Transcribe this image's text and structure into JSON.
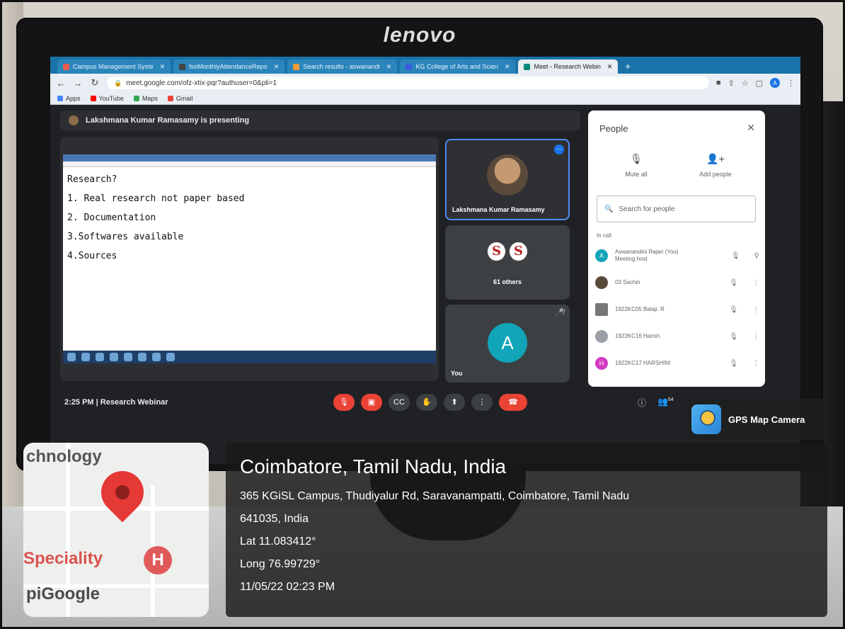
{
  "monitor": {
    "brand": "lenovo"
  },
  "browser": {
    "tabs": [
      {
        "label": "Campus Management Syste",
        "active": false
      },
      {
        "label": "fsoMonthlyAttendanceRepo",
        "active": false
      },
      {
        "label": "Search results - aswanandi",
        "active": false
      },
      {
        "label": "KG College of Arts and Scien",
        "active": false
      },
      {
        "label": "Meet - Research Webin",
        "active": true
      }
    ],
    "new_tab": "+",
    "url": "meet.google.com/ofz-xtix-pqr?authuser=0&pli=1",
    "bookmarks": [
      {
        "label": "Apps",
        "color": "#4285f4"
      },
      {
        "label": "YouTube",
        "color": "#ff0000"
      },
      {
        "label": "Maps",
        "color": "#34a853"
      },
      {
        "label": "Gmail",
        "color": "#ea4335"
      }
    ],
    "profile_initial": "A"
  },
  "meet": {
    "presenting_text": "Lakshmana Kumar Ramasamy is presenting",
    "shared_screen_lines": [
      "Research?",
      "1. Real research not paper based",
      "2. Documentation",
      "3.Softwares available",
      "4.Sources"
    ],
    "tiles": {
      "speaker_name": "Lakshmana Kumar Ramasamy",
      "others_label": "61 others",
      "logo_letters": [
        "S",
        "S"
      ],
      "you_initial": "A",
      "you_label": "You"
    },
    "people_panel": {
      "title": "People",
      "mute_all": "Mute all",
      "add_people": "Add people",
      "search_placeholder": "Search for people",
      "in_call_label": "In call",
      "participants": [
        {
          "name": "Aswanandini Rajan (You)",
          "sub": "Meeting host",
          "initial": "A",
          "color": "#12a4b8"
        },
        {
          "name": "03 Sachin",
          "sub": "",
          "initial": "",
          "color": "#5a4a3a"
        },
        {
          "name": "1922KC05 Balaji. R",
          "sub": "",
          "initial": "",
          "color": "#777777"
        },
        {
          "name": "1922KC16 Harish",
          "sub": "",
          "initial": "",
          "color": "#9aa0a6"
        },
        {
          "name": "1922KC17 HARSHINI",
          "sub": "",
          "initial": "H",
          "color": "#d23bc0"
        }
      ]
    },
    "bottom": {
      "time": "2:25 PM",
      "separator": "|",
      "meeting_name": "Research Webinar",
      "participant_count": "64"
    }
  },
  "gps": {
    "app_label": "GPS Map Camera",
    "city": "Coimbatore, Tamil Nadu, India",
    "address_line1": "365 KGiSL Campus, Thudiyalur Rd, Saravanampatti, Coimbatore, Tamil Nadu",
    "address_line2": "641035, India",
    "lat": "Lat 11.083412°",
    "long": "Long 76.99729°",
    "datetime": "11/05/22 02:23 PM"
  },
  "map": {
    "label_top": "chnology",
    "label_mid": "Speciality",
    "label_bottom": "pi",
    "google": "Google",
    "hospital_letter": "H"
  }
}
